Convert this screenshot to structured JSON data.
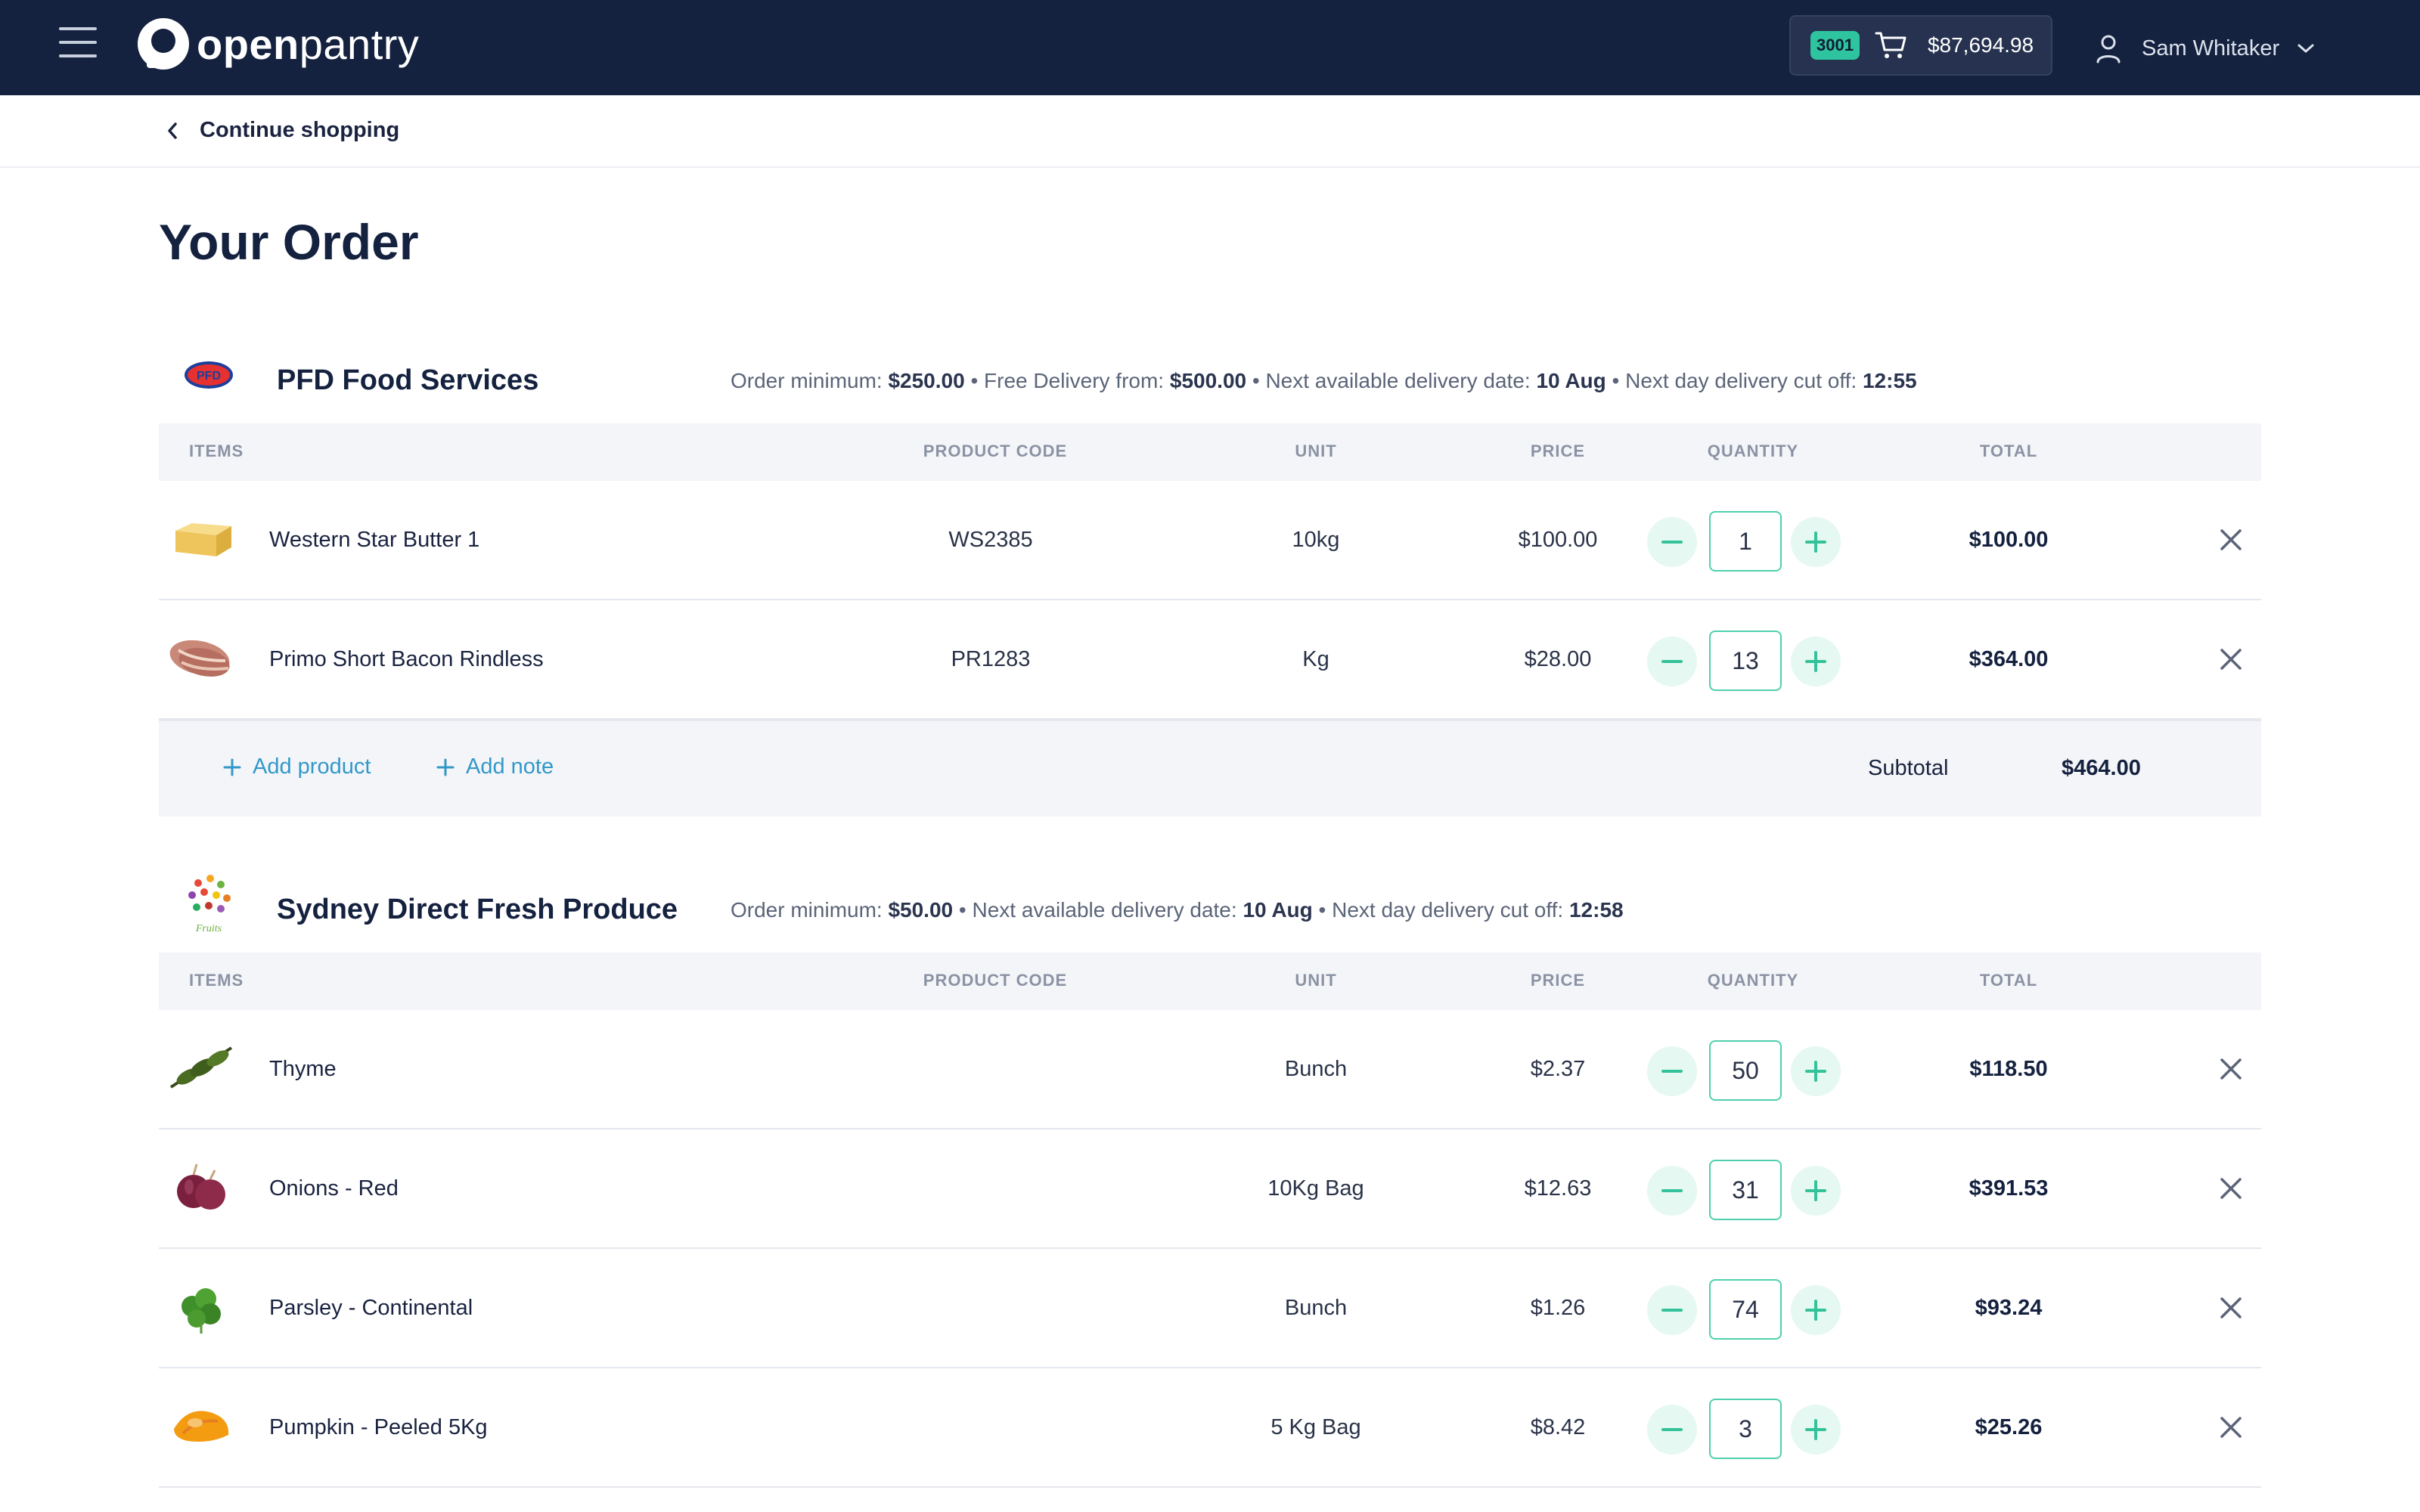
{
  "header": {
    "logo_light": "open",
    "logo_bold": "pantry",
    "cart_badge": "3001",
    "cart_total": "$87,694.98",
    "user_name": "Sam Whitaker"
  },
  "subnav": {
    "continue_label": "Continue shopping"
  },
  "page": {
    "title": "Your Order"
  },
  "columns": {
    "items": "ITEMS",
    "product_code": "PRODUCT CODE",
    "unit": "UNIT",
    "price": "PRICE",
    "quantity": "QUANTITY",
    "total": "TOTAL"
  },
  "suppliers": [
    {
      "name": "PFD Food Services",
      "logo_icon": "pfd-logo",
      "meta": {
        "order_min_label": "Order minimum: ",
        "order_min": "$250.00",
        "free_delivery_label": " • Free Delivery from: ",
        "free_delivery": "$500.00",
        "next_date_label": " • Next available delivery date: ",
        "next_date": "10 Aug",
        "cutoff_label": " • Next day delivery cut off: ",
        "cutoff": "12:55"
      },
      "items": [
        {
          "name": "Western Star Butter 1",
          "code": "WS2385",
          "unit": "10kg",
          "price": "$100.00",
          "qty": "1",
          "total": "$100.00",
          "image_icon": "butter-icon"
        },
        {
          "name": "Primo Short Bacon Rindless",
          "code": "PR1283",
          "unit": "Kg",
          "price": "$28.00",
          "qty": "13",
          "total": "$364.00",
          "image_icon": "bacon-icon"
        }
      ],
      "footer": {
        "add_product": "Add product",
        "add_note": "Add note",
        "subtotal_label": "Subtotal",
        "subtotal": "$464.00"
      }
    },
    {
      "name": "Sydney Direct Fresh Produce",
      "logo_icon": "fruits-logo",
      "meta": {
        "order_min_label": "Order minimum: ",
        "order_min": "$50.00",
        "next_date_label": " • Next available delivery date: ",
        "next_date": "10 Aug",
        "cutoff_label": " • Next day delivery cut off: ",
        "cutoff": "12:58"
      },
      "items": [
        {
          "name": "Thyme",
          "code": "",
          "unit": "Bunch",
          "price": "$2.37",
          "qty": "50",
          "total": "$118.50",
          "image_icon": "thyme-icon"
        },
        {
          "name": "Onions - Red",
          "code": "",
          "unit": "10Kg Bag",
          "price": "$12.63",
          "qty": "31",
          "total": "$391.53",
          "image_icon": "onion-icon"
        },
        {
          "name": "Parsley - Continental",
          "code": "",
          "unit": "Bunch",
          "price": "$1.26",
          "qty": "74",
          "total": "$93.24",
          "image_icon": "parsley-icon"
        },
        {
          "name": "Pumpkin - Peeled 5Kg",
          "code": "",
          "unit": "5 Kg Bag",
          "price": "$8.42",
          "qty": "3",
          "total": "$25.26",
          "image_icon": "pumpkin-icon"
        }
      ]
    }
  ],
  "colors": {
    "navbar": "#14213f",
    "accent_green": "#33c29a",
    "link_blue": "#3298c9",
    "badge_green": "#2ec4a0"
  }
}
